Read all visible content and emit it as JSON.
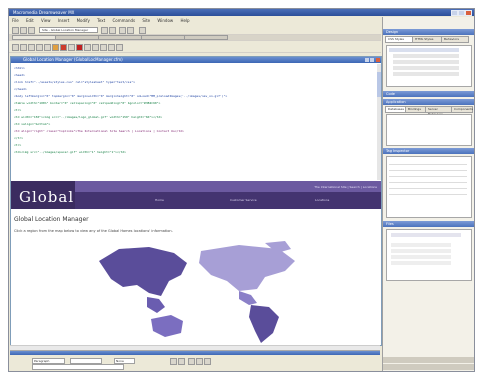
{
  "window": {
    "title": "Macromedia Dreamweaver MX"
  },
  "menu": [
    "File",
    "Edit",
    "View",
    "Insert",
    "Modify",
    "Text",
    "Commands",
    "Site",
    "Window",
    "Help"
  ],
  "toolbar": {
    "site_dropdown": "Site - Global Location Manager"
  },
  "document": {
    "title": "Global Location Manager (GlobalLocManager.cfm)",
    "code_lines": [
      "<html>",
      "<head>",
      "<link href=\"../assets/styles.css\" rel=\"stylesheet\" type=\"text/css\">",
      "</head>",
      "<body leftmargin=\"0\" topmargin=\"0\" marginwidth=\"0\" marginheight=\"0\" onLoad=\"MM_preloadImages('../images/nav_on.gif')\">",
      "<table width=\"100%\" border=\"0\" cellspacing=\"0\" cellpadding=\"0\" bgcolor=\"#3B2C60\">",
      "  <tr>",
      "    <td width=\"150\"><img src=\"../images/logo_global.gif\" width=\"150\" height=\"60\"></td>",
      "    <td valign=\"bottom\">",
      "<td align=\"right\" class=\"toplinks\">The International Site Search | Locations | Contact Us</td>",
      "  </tr>",
      "  <tr>",
      "    <td><img src=\"../images/spacer.gif\" width=\"1\" height=\"1\"></td>"
    ]
  },
  "site": {
    "logo": "Global",
    "toplinks": "The International Site | Search | Locations",
    "nav": [
      "Home",
      "Customer Service",
      "Locations"
    ],
    "heading": "Global Location Manager",
    "intro": "Click a region from the map below to view any of the Global Homes locations' information."
  },
  "properties": {
    "format": "Paragraph",
    "size": "None"
  },
  "panels": {
    "design": {
      "title": "Design",
      "tabs": [
        "CSS Styles",
        "HTML Styles",
        "Behaviors"
      ]
    },
    "code": {
      "title": "Code"
    },
    "application": {
      "title": "Application",
      "tabs": [
        "Databases",
        "Bindings",
        "Server Behaviors",
        "Components"
      ]
    },
    "tag_inspector": {
      "title": "Tag Inspector"
    },
    "files": {
      "title": "Files"
    }
  },
  "colors": {
    "site_header": "#3B2C60",
    "nav_bar": "#443470",
    "map_region": "#5a4d9a",
    "map_region_light": "#a79fd6"
  }
}
